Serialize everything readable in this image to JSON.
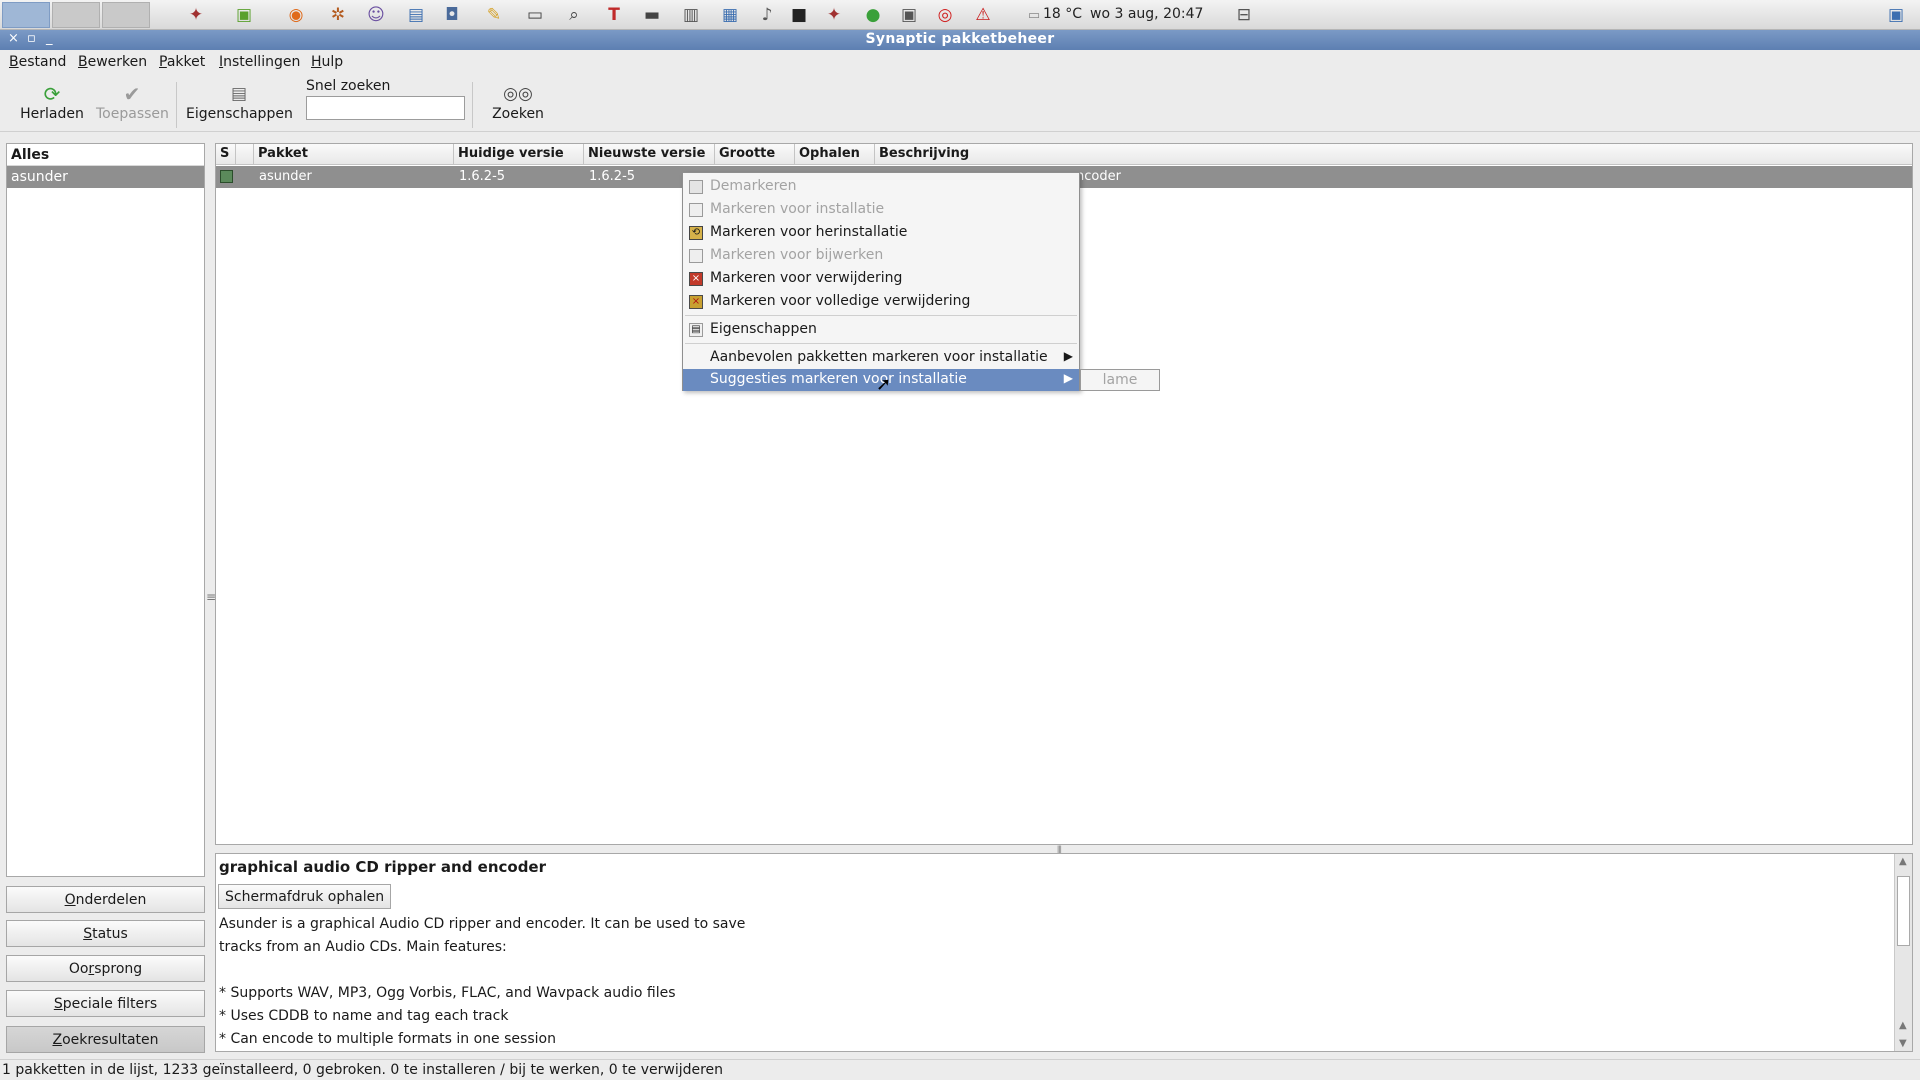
{
  "panel": {
    "weather": "18 °C",
    "clock": "wo  3 aug, 20:47"
  },
  "window": {
    "title": "Synaptic pakketbeheer"
  },
  "menubar": {
    "items": [
      {
        "accel": "B",
        "rest": "estand"
      },
      {
        "accel": "B",
        "rest": "ewerken"
      },
      {
        "accel": "P",
        "rest": "akket"
      },
      {
        "accel": "I",
        "rest": "nstellingen"
      },
      {
        "accel": "H",
        "rest": "ulp"
      }
    ]
  },
  "toolbar": {
    "reload_label": "Herladen",
    "apply_label": "Toepassen",
    "properties_label": "Eigenschappen",
    "quick_search_label": "Snel zoeken",
    "quick_search_value": "",
    "search_label": "Zoeken"
  },
  "filters": {
    "header": "Alles",
    "items": [
      "asunder"
    ]
  },
  "side_buttons": [
    {
      "accel": "O",
      "rest": "nderdelen"
    },
    {
      "accel": "S",
      "rest": "tatus"
    },
    {
      "accel": "",
      "pre": "Oo",
      "accel2": "r",
      "rest": "sprong"
    },
    {
      "accel": "S",
      "rest": "peciale filters"
    },
    {
      "accel": "Z",
      "rest": "oekresultaten"
    }
  ],
  "package_list": {
    "columns": [
      "S",
      "",
      "Pakket",
      "Huidige versie",
      "Nieuwste versie",
      "Grootte",
      "Ophalen",
      "Beschrijving"
    ],
    "rows": [
      {
        "name": "asunder",
        "installed": "1.6.2-5",
        "latest": "1.6.2-5",
        "description_tail": "encoder"
      }
    ]
  },
  "context_menu": {
    "items": [
      {
        "label": "Demarkeren",
        "enabled": false
      },
      {
        "label": "Markeren voor installatie",
        "enabled": false
      },
      {
        "label": "Markeren voor herinstallatie",
        "enabled": true
      },
      {
        "label": "Markeren voor bijwerken",
        "enabled": false
      },
      {
        "label": "Markeren voor verwijdering",
        "enabled": true
      },
      {
        "label": "Markeren voor volledige verwijdering",
        "enabled": true
      },
      {
        "label": "Eigenschappen",
        "enabled": true
      },
      {
        "label": "Aanbevolen pakketten markeren voor installatie",
        "enabled": true
      },
      {
        "label": "Suggesties markeren voor installatie",
        "enabled": true
      }
    ],
    "submenu_item": "lame"
  },
  "details": {
    "title": "graphical audio CD ripper and encoder",
    "screenshot_button": "Schermafdruk ophalen",
    "lines": [
      "Asunder is a graphical Audio CD ripper and encoder. It can be used to save",
      "tracks from an Audio CDs. Main features:",
      "",
      "* Supports WAV, MP3, Ogg Vorbis, FLAC, and Wavpack audio files",
      "* Uses CDDB to name and tag each track",
      "* Can encode to multiple formats in one session"
    ]
  },
  "statusbar": {
    "text": "1 pakketten in de lijst, 1233 geïnstalleerd, 0 gebroken. 0 te installeren / bij te werken, 0 te verwijderen"
  },
  "colors": {
    "titlebar": "#6a8bc0",
    "selection": "#8f8f8f",
    "menu_highlight": "#6a8bc0"
  }
}
